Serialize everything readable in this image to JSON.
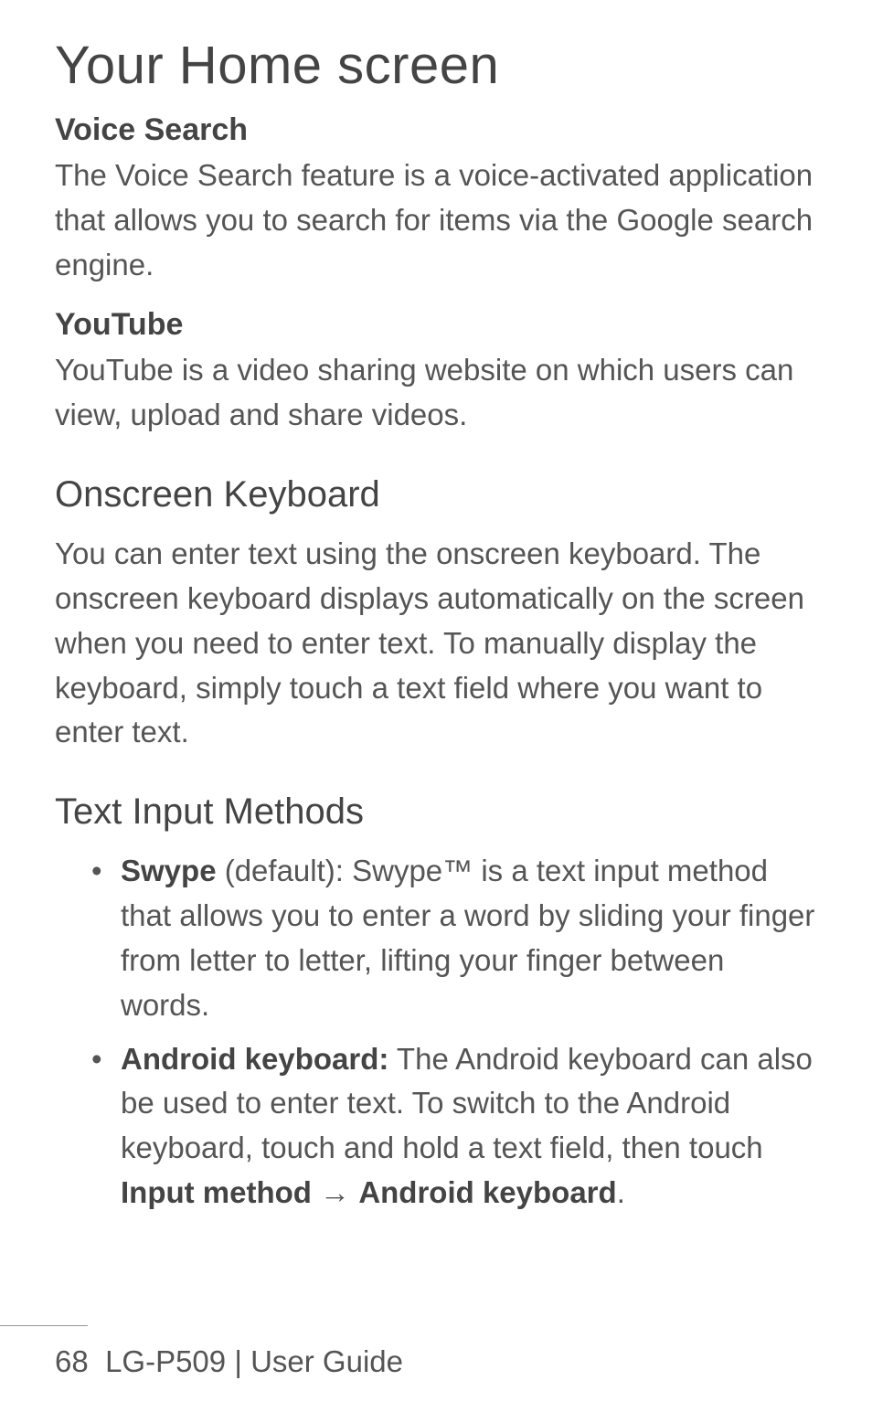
{
  "title": "Your Home screen",
  "sections": {
    "voiceSearch": {
      "heading": "Voice Search",
      "body": "The Voice Search feature is a voice-activated application that allows you to search for items via the Google search engine."
    },
    "youtube": {
      "heading": "YouTube",
      "body": "YouTube is a video sharing website on which users can view, upload and share videos."
    },
    "onscreenKeyboard": {
      "heading": "Onscreen Keyboard",
      "body": "You can enter text using the onscreen keyboard. The onscreen keyboard displays automatically on the screen when you need to enter text. To manually display the keyboard, simply touch a text field where you want to enter text."
    },
    "textInputMethods": {
      "heading": "Text Input Methods",
      "items": {
        "swype": {
          "label": "Swype",
          "rest": " (default): Swype™ is a text input method that allows you to enter a word by sliding your finger from letter to letter, lifting your finger between words."
        },
        "android": {
          "label": "Android keyboard:",
          "part1": " The Android keyboard can also be used to enter text. To switch to the Android keyboard, touch and hold a text field, then touch ",
          "bold1": "Input method",
          "arrow": " → ",
          "bold2": "Android keyboard",
          "end": "."
        }
      }
    }
  },
  "footer": {
    "pageNumber": "68",
    "model": "LG-P509",
    "separator": "  |  ",
    "label": "User Guide"
  }
}
